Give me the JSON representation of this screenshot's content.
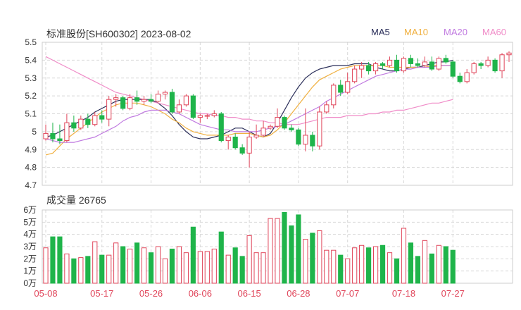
{
  "header": {
    "title": "标准股份[SH600302] 2023-08-02",
    "volume_label": "成交量 26765"
  },
  "legend": [
    {
      "label": "MA5",
      "color": "#2b2f5a"
    },
    {
      "label": "MA10",
      "color": "#f0b040"
    },
    {
      "label": "MA20",
      "color": "#c07ae0"
    },
    {
      "label": "MA60",
      "color": "#f08cc8"
    }
  ],
  "colors": {
    "up": "#e0455a",
    "down": "#1fb44a",
    "grid": "#d8d8d8",
    "axis_text": "#333333",
    "date_text": "#e0455a"
  },
  "chart_data": {
    "type": "candlestick",
    "price_axis": {
      "ticks": [
        "5.5",
        "5.4",
        "5.3",
        "5.2",
        "5.1",
        "5",
        "4.9",
        "4.8",
        "4.7"
      ],
      "ylim": [
        4.7,
        5.5
      ]
    },
    "volume_axis": {
      "ticks": [
        "6万",
        "5万",
        "4万",
        "3万",
        "2万",
        "1万",
        "0万"
      ],
      "ylim": [
        0,
        60000
      ]
    },
    "x_labels": [
      "05-08",
      "05-17",
      "05-26",
      "06-06",
      "06-15",
      "06-28",
      "07-07",
      "07-18",
      "07-27"
    ],
    "x_label_index": [
      0,
      8,
      15,
      22,
      29,
      36,
      43,
      51,
      58
    ],
    "candles": [
      [
        4.96,
        4.99,
        5.04,
        4.95
      ],
      [
        4.99,
        4.96,
        5.05,
        4.94
      ],
      [
        4.96,
        4.95,
        5.04,
        4.93
      ],
      [
        4.95,
        5.05,
        5.1,
        4.94
      ],
      [
        5.05,
        5.02,
        5.09,
        5.0
      ],
      [
        5.02,
        5.07,
        5.09,
        5.01
      ],
      [
        5.07,
        5.04,
        5.1,
        5.02
      ],
      [
        5.04,
        5.09,
        5.11,
        5.03
      ],
      [
        5.09,
        5.07,
        5.12,
        5.05
      ],
      [
        5.07,
        5.18,
        5.2,
        5.03
      ],
      [
        5.18,
        5.19,
        5.21,
        5.14
      ],
      [
        5.19,
        5.13,
        5.2,
        5.12
      ],
      [
        5.13,
        5.19,
        5.21,
        5.12
      ],
      [
        5.19,
        5.17,
        5.23,
        5.15
      ],
      [
        5.17,
        5.18,
        5.2,
        5.15
      ],
      [
        5.18,
        5.17,
        5.21,
        5.16
      ],
      [
        5.17,
        5.21,
        5.23,
        5.16
      ],
      [
        5.21,
        5.22,
        5.23,
        5.18
      ],
      [
        5.22,
        5.11,
        5.24,
        5.1
      ],
      [
        5.11,
        5.15,
        5.18,
        5.1
      ],
      [
        5.15,
        5.2,
        5.21,
        5.14
      ],
      [
        5.2,
        5.08,
        5.21,
        5.07
      ],
      [
        5.08,
        5.09,
        5.1,
        5.05
      ],
      [
        5.09,
        5.09,
        5.1,
        5.07
      ],
      [
        5.09,
        5.1,
        5.12,
        5.08
      ],
      [
        5.1,
        4.95,
        5.11,
        4.94
      ],
      [
        4.95,
        4.97,
        4.98,
        4.9
      ],
      [
        4.97,
        4.91,
        4.99,
        4.9
      ],
      [
        4.91,
        4.88,
        4.93,
        4.87
      ],
      [
        4.88,
        4.97,
        5.0,
        4.8
      ],
      [
        4.97,
        4.98,
        5.04,
        4.96
      ],
      [
        4.98,
        5.02,
        5.06,
        4.97
      ],
      [
        5.02,
        5.03,
        5.04,
        5.01
      ],
      [
        5.03,
        5.08,
        5.13,
        5.02
      ],
      [
        5.08,
        5.02,
        5.09,
        5.01
      ],
      [
        5.02,
        5.01,
        5.04,
        5.0
      ],
      [
        5.01,
        4.93,
        5.02,
        4.92
      ],
      [
        4.93,
        4.98,
        5.13,
        4.89
      ],
      [
        4.98,
        4.92,
        5.0,
        4.89
      ],
      [
        4.92,
        5.11,
        5.14,
        4.9
      ],
      [
        5.11,
        5.15,
        5.17,
        5.1
      ],
      [
        5.15,
        5.26,
        5.27,
        5.13
      ],
      [
        5.26,
        5.22,
        5.29,
        5.2
      ],
      [
        5.22,
        5.28,
        5.33,
        5.21
      ],
      [
        5.28,
        5.35,
        5.37,
        5.27
      ],
      [
        5.35,
        5.37,
        5.39,
        5.3
      ],
      [
        5.37,
        5.34,
        5.39,
        5.32
      ],
      [
        5.34,
        5.38,
        5.39,
        5.32
      ],
      [
        5.38,
        5.37,
        5.39,
        5.35
      ],
      [
        5.37,
        5.4,
        5.42,
        5.36
      ],
      [
        5.4,
        5.34,
        5.43,
        5.33
      ],
      [
        5.34,
        5.41,
        5.42,
        5.33
      ],
      [
        5.41,
        5.38,
        5.43,
        5.36
      ],
      [
        5.38,
        5.37,
        5.41,
        5.36
      ],
      [
        5.37,
        5.39,
        5.42,
        5.36
      ],
      [
        5.39,
        5.35,
        5.42,
        5.34
      ],
      [
        5.35,
        5.41,
        5.42,
        5.34
      ],
      [
        5.41,
        5.39,
        5.43,
        5.38
      ],
      [
        5.39,
        5.31,
        5.4,
        5.3
      ],
      [
        5.31,
        5.28,
        5.33,
        5.27
      ],
      [
        5.28,
        5.33,
        5.35,
        5.27
      ],
      [
        5.33,
        5.38,
        5.39,
        5.32
      ],
      [
        5.38,
        5.37,
        5.39,
        5.35
      ],
      [
        5.37,
        5.4,
        5.42,
        5.36
      ],
      [
        5.4,
        5.34,
        5.41,
        5.33
      ],
      [
        5.34,
        5.43,
        5.44,
        5.3
      ],
      [
        5.43,
        5.44,
        5.45,
        5.39
      ]
    ],
    "volume": [
      29000,
      38000,
      38000,
      24000,
      20000,
      21000,
      22000,
      34000,
      23000,
      23000,
      33000,
      30000,
      28000,
      33000,
      29000,
      25000,
      30000,
      20000,
      28000,
      30000,
      25000,
      46000,
      26000,
      26000,
      28000,
      42000,
      23000,
      29000,
      22000,
      39000,
      25000,
      25000,
      53000,
      53000,
      58000,
      47000,
      56000,
      36000,
      41000,
      43000,
      27000,
      27000,
      23000,
      20000,
      29000,
      31000,
      29000,
      30000,
      31000,
      25000,
      20000,
      45000,
      33000,
      22000,
      35000,
      24000,
      31000,
      30000,
      27000
    ],
    "ma": {
      "MA5": [
        4.97,
        4.98,
        5.0,
        5.02,
        5.04,
        5.06,
        5.08,
        5.11,
        5.13,
        5.15,
        5.17,
        5.18,
        5.18,
        5.18,
        5.18,
        5.18,
        5.16,
        5.13,
        5.09,
        5.04,
        5.0,
        4.97,
        4.96,
        4.96,
        4.97,
        4.98,
        5.0,
        5.02,
        5.02,
        5.0,
        4.98,
        4.97,
        4.99,
        5.05,
        5.12,
        5.19,
        5.25,
        5.3,
        5.33,
        5.35,
        5.36,
        5.37,
        5.37,
        5.37,
        5.38,
        5.38,
        5.38,
        5.36,
        5.35,
        5.34,
        5.34,
        5.35,
        5.36,
        5.36,
        5.37,
        5.38,
        5.39,
        5.39,
        5.4
      ],
      "MA10": [
        4.87,
        4.88,
        4.92,
        4.96,
        4.99,
        5.02,
        5.05,
        5.08,
        5.11,
        5.13,
        5.15,
        5.16,
        5.16,
        5.16,
        5.15,
        5.14,
        5.12,
        5.1,
        5.07,
        5.05,
        5.02,
        5.0,
        4.99,
        4.98,
        4.98,
        4.98,
        4.98,
        4.99,
        4.99,
        4.99,
        4.98,
        4.97,
        4.98,
        5.01,
        5.05,
        5.1,
        5.15,
        5.2,
        5.25,
        5.29,
        5.31,
        5.33,
        5.35,
        5.36,
        5.37,
        5.37,
        5.37,
        5.37,
        5.37,
        5.36,
        5.36,
        5.36,
        5.36,
        5.36,
        5.36,
        5.37,
        5.37,
        5.37,
        5.37
      ],
      "MA20": [
        4.96,
        4.95,
        4.94,
        4.94,
        4.94,
        4.95,
        4.96,
        4.97,
        4.99,
        5.01,
        5.03,
        5.06,
        5.08,
        5.09,
        5.11,
        5.12,
        5.12,
        5.12,
        5.11,
        5.1,
        5.08,
        5.06,
        5.04,
        5.03,
        5.02,
        5.01,
        5.01,
        5.0,
        5.0,
        5.0,
        5.0,
        5.01,
        5.02,
        5.03,
        5.04,
        5.06,
        5.08,
        5.1,
        5.12,
        5.14,
        5.17,
        5.19,
        5.21,
        5.23,
        5.25,
        5.27,
        5.29,
        5.31,
        5.32,
        5.33,
        5.34,
        5.35,
        5.35,
        5.36,
        5.36,
        5.36,
        5.37,
        5.37,
        5.37
      ],
      "MA60": [
        5.42,
        5.4,
        5.38,
        5.36,
        5.34,
        5.32,
        5.3,
        5.28,
        5.26,
        5.24,
        5.22,
        5.21,
        5.2,
        5.19,
        5.18,
        5.17,
        5.16,
        5.15,
        5.14,
        5.13,
        5.12,
        5.11,
        5.1,
        5.1,
        5.09,
        5.09,
        5.08,
        5.08,
        5.07,
        5.07,
        5.06,
        5.06,
        5.05,
        5.05,
        5.04,
        5.04,
        5.04,
        5.05,
        5.06,
        5.07,
        5.08,
        5.08,
        5.08,
        5.09,
        5.09,
        5.09,
        5.1,
        5.1,
        5.11,
        5.11,
        5.12,
        5.12,
        5.13,
        5.14,
        5.15,
        5.16,
        5.16,
        5.17,
        5.18
      ]
    }
  }
}
